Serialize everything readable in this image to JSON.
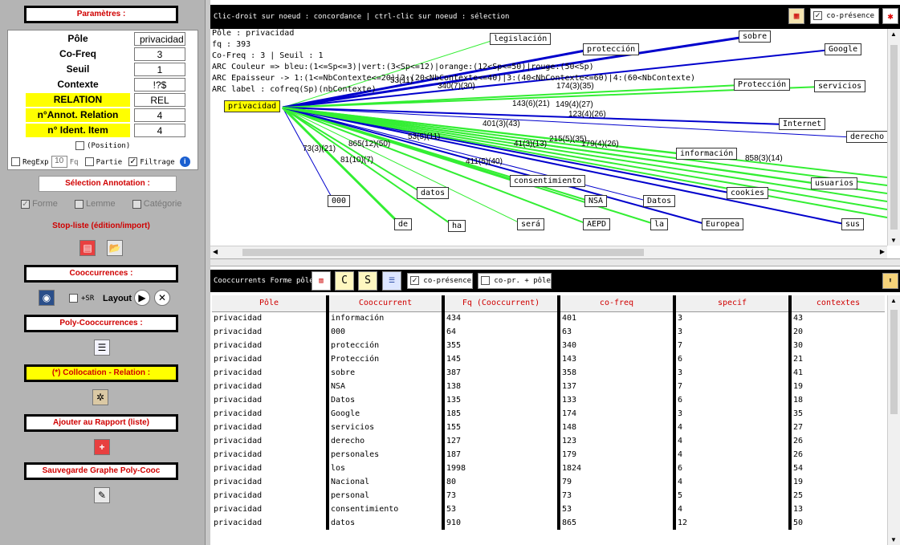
{
  "left": {
    "params_title": "Paramètres :",
    "rows": [
      {
        "label": "Pôle",
        "value": "privacidad"
      },
      {
        "label": "Co-Freq",
        "value": "3"
      },
      {
        "label": "Seuil",
        "value": "1"
      },
      {
        "label": "Contexte",
        "value": "!?$"
      },
      {
        "label": "RELATION",
        "value": "REL"
      },
      {
        "label": "n°Annot. Relation",
        "value": "4"
      },
      {
        "label": "n° Ident. Item",
        "value": "4"
      }
    ],
    "position_label": "(Position)",
    "regexp_label": "RegExp",
    "fq_value": "10",
    "fq_label": "Fq",
    "partie_label": "Partie",
    "filtrage_label": "Filtrage",
    "selection_title": "Sélection Annotation :",
    "forme_label": "Forme",
    "lemme_label": "Lemme",
    "categorie_label": "Catégorie",
    "stoplist_label": "Stop-liste (édition/import)",
    "cooc_title": "Cooccurrences :",
    "sr_label": "+SR",
    "layout_label": "Layout",
    "polycooc_title": "Poly-Cooccurrences :",
    "collocation_title": "(*) Collocation - Relation :",
    "rapport_title": "Ajouter au Rapport (liste)",
    "sauvegarde_title": "Sauvegarde Graphe Poly-Cooc"
  },
  "graph": {
    "title": "Clic-droit sur noeud : concordance | ctrl-clic sur noeud : sélection",
    "copresence_label": "co-présence",
    "info": [
      "Pôle : privacidad",
      "fq : 393",
      "Co-Freq : 3 | Seuil : 1",
      "ARC Couleur => bleu:(1<=Sp<=3)|vert:(3<Sp<=12)|orange:(12<Sp<=50)|rouge:(50<Sp)",
      "ARC Epaisseur -> 1:(1<=NbContexte<=20)|2:(20<NbContexte<=40)|3:(40<NbContexte<=60)|4:(60<NbContexte)",
      "ARC label : cofreq(Sp)(nbContexte)"
    ],
    "pole": "privacidad",
    "nodes": [
      "legislación",
      "protección",
      "sobre",
      "Google",
      "Protección",
      "servicios",
      "Internet",
      "derecho",
      "información",
      "cookies",
      "usuarios",
      "000",
      "datos",
      "de",
      "ha",
      "será",
      "consentimiento",
      "NSA",
      "AEPD",
      "Datos",
      "la",
      "Europea",
      "sus"
    ],
    "edge_labels": [
      "53(11)",
      "340(7)(30)",
      "174(3)(35)",
      "143(6)(21)",
      "149(4)(27)",
      "123(4)(26)",
      "401(3)(43)",
      "53(5)(11)",
      "215(5)(35)",
      "41(3)(13)",
      "73(3)(21)",
      "865(12)(50)",
      "411(5)(40)",
      "81(10)(7)",
      "858(3)(14)",
      "179(4)(26)"
    ]
  },
  "table": {
    "title": "Cooccurrents Forme pôle",
    "copresence_label": "co-présence",
    "copr_pole_label": "co-pr. + pôle",
    "headers": [
      "Pôle",
      "Cooccurrent",
      "Fq (Cooccurrent)",
      "co-freq",
      "specif",
      "contextes"
    ],
    "rows": [
      [
        "privacidad",
        "información",
        "434",
        "401",
        "3",
        "43"
      ],
      [
        "privacidad",
        "000",
        "64",
        "63",
        "3",
        "20"
      ],
      [
        "privacidad",
        "protección",
        "355",
        "340",
        "7",
        "30"
      ],
      [
        "privacidad",
        "Protección",
        "145",
        "143",
        "6",
        "21"
      ],
      [
        "privacidad",
        "sobre",
        "387",
        "358",
        "3",
        "41"
      ],
      [
        "privacidad",
        "NSA",
        "138",
        "137",
        "7",
        "19"
      ],
      [
        "privacidad",
        "Datos",
        "135",
        "133",
        "6",
        "18"
      ],
      [
        "privacidad",
        "Google",
        "185",
        "174",
        "3",
        "35"
      ],
      [
        "privacidad",
        "servicios",
        "155",
        "148",
        "4",
        "27"
      ],
      [
        "privacidad",
        "derecho",
        "127",
        "123",
        "4",
        "26"
      ],
      [
        "privacidad",
        "personales",
        "187",
        "179",
        "4",
        "26"
      ],
      [
        "privacidad",
        "los",
        "1998",
        "1824",
        "6",
        "54"
      ],
      [
        "privacidad",
        "Nacional",
        "80",
        "79",
        "4",
        "19"
      ],
      [
        "privacidad",
        "personal",
        "73",
        "73",
        "5",
        "25"
      ],
      [
        "privacidad",
        "consentimiento",
        "53",
        "53",
        "4",
        "13"
      ],
      [
        "privacidad",
        "datos",
        "910",
        "865",
        "12",
        "50"
      ]
    ]
  },
  "colors": {
    "blue": "#0000cc",
    "green": "#33ee33",
    "yellow": "#ffff00",
    "red": "#d00000"
  }
}
